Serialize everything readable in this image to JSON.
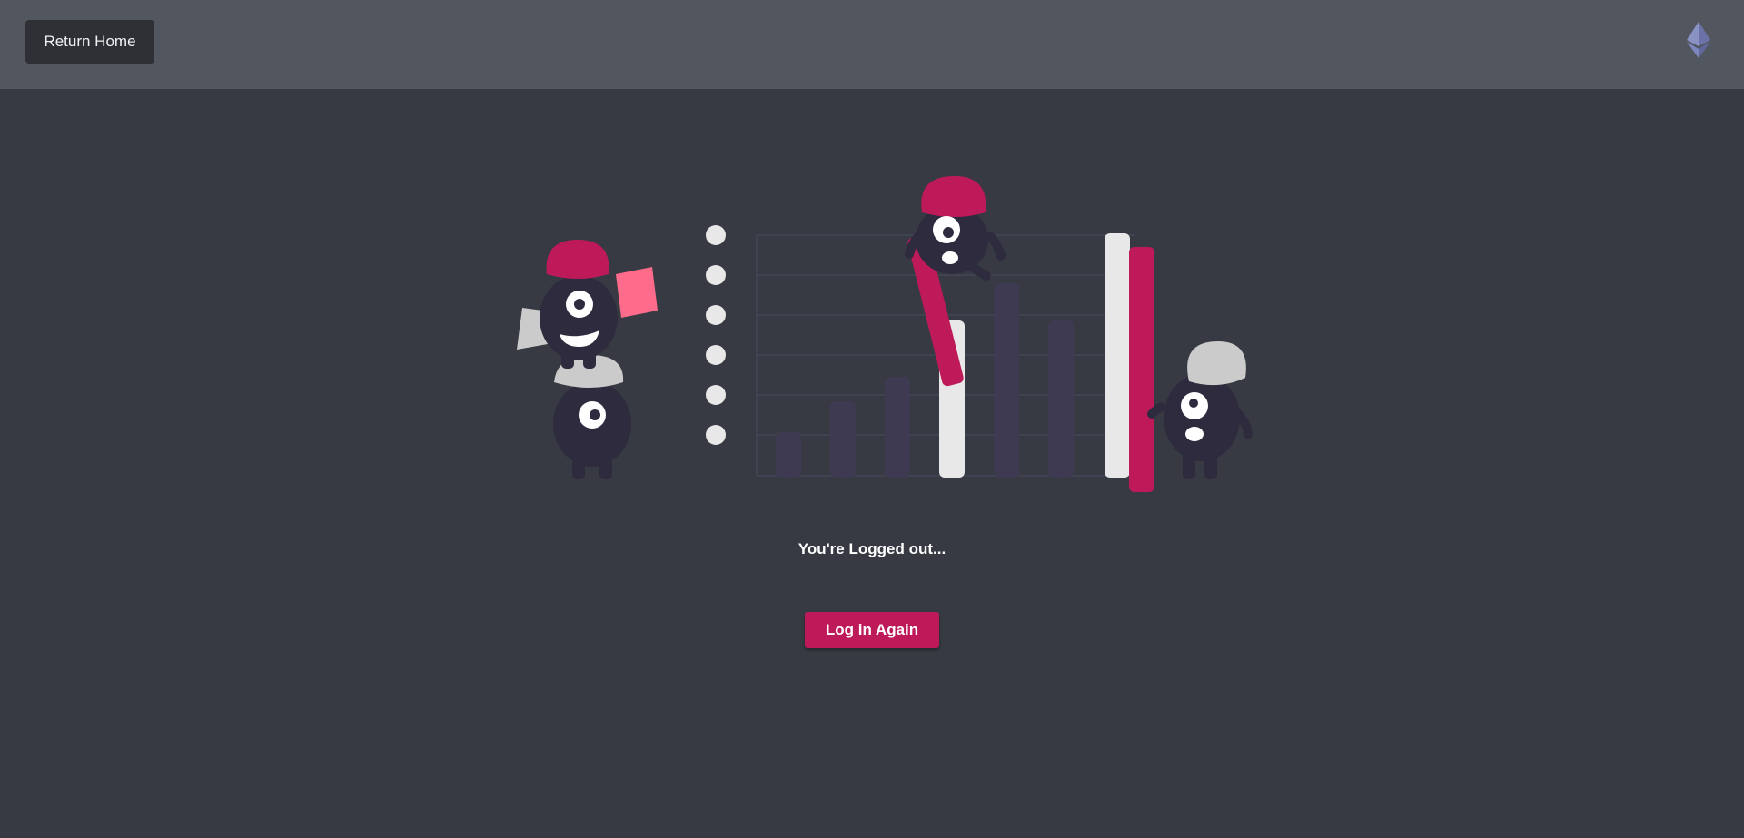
{
  "header": {
    "return_home_label": "Return Home",
    "logo_icon": "ethereum-icon"
  },
  "main": {
    "status_text": "You're Logged out...",
    "login_again_label": "Log in Again"
  },
  "colors": {
    "page_bg": "#373a42",
    "header_bg": "#52565f",
    "accent": "#be1a5a",
    "dark_button": "#2f3036",
    "bar_dark": "#3e3a52",
    "bar_light": "#e8e8e8"
  }
}
